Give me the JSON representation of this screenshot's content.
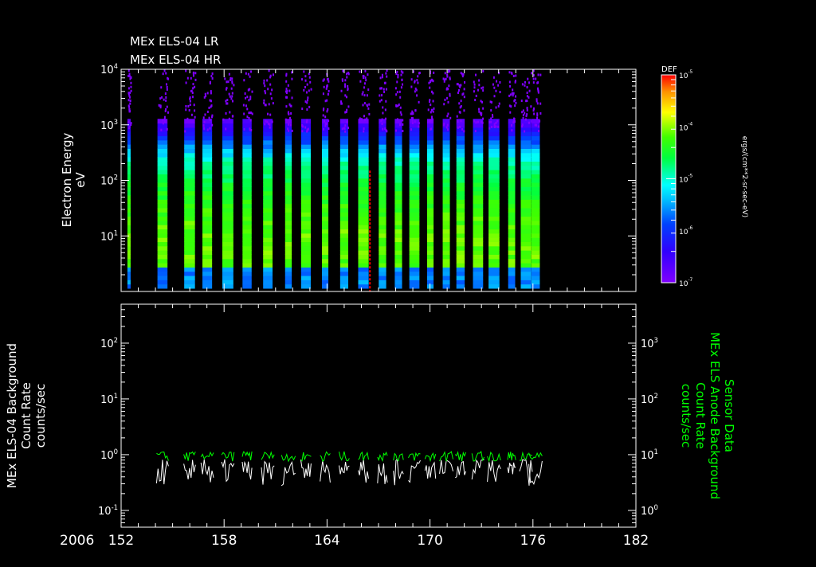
{
  "titles": [
    "MEx ELS-04 LR",
    "MEx ELS-04 HR"
  ],
  "year_label": "2006",
  "colors": {
    "axis": "#ffffff",
    "green_series": "#00ff00",
    "white_series": "#ffffff",
    "marker_line": "#ff0000"
  },
  "chart_data": [
    {
      "type": "heatmap",
      "title": "MEx ELS-04 LR / MEx ELS-04 HR",
      "ylabel": "Electron Energy",
      "yunits": "eV",
      "yscale": "log",
      "ylim": [
        1,
        10000
      ],
      "yticks": [
        {
          "base": "10",
          "exp": "1"
        },
        {
          "base": "10",
          "exp": "2"
        },
        {
          "base": "10",
          "exp": "3"
        },
        {
          "base": "10",
          "exp": "4"
        }
      ],
      "xlim": [
        152,
        182
      ],
      "pass_days": [
        152.46,
        154.41,
        155.99,
        157.02,
        158.22,
        159.34,
        160.55,
        161.75,
        162.77,
        163.89,
        165.0,
        166.12,
        167.23,
        168.16,
        169.09,
        170.02,
        170.95,
        171.78,
        172.8,
        173.73,
        174.76,
        175.59,
        176.15
      ],
      "marker_day": 166.5,
      "colorbar": {
        "label": "DEF",
        "units": "ergs/(cm**2-sr-sec-eV)",
        "scale": "log",
        "range": [
          1e-07,
          1e-05
        ],
        "ticks": [
          {
            "base": "10",
            "exp": "-5"
          },
          {
            "base": "10",
            "exp": "-4"
          },
          {
            "base": "10",
            "exp": "-5"
          },
          {
            "base": "10",
            "exp": "-6"
          },
          {
            "base": "10",
            "exp": "-7"
          }
        ]
      }
    },
    {
      "type": "line",
      "ylabel_left": [
        "MEx ELS-04 Background",
        "Count Rate",
        "counts/sec"
      ],
      "ylabel_right": [
        "Sensor Data",
        "MEx ELS Anode Background",
        "Count Rate",
        "counts/sec"
      ],
      "yscale": "log",
      "ylim_left": [
        0.05,
        500
      ],
      "ylim_right": [
        0.5,
        5000
      ],
      "yticks_left": [
        {
          "base": "10",
          "exp": "-1"
        },
        {
          "base": "10",
          "exp": "0"
        },
        {
          "base": "10",
          "exp": "1"
        },
        {
          "base": "10",
          "exp": "2"
        }
      ],
      "yticks_right": [
        {
          "base": "10",
          "exp": "0"
        },
        {
          "base": "10",
          "exp": "1"
        },
        {
          "base": "10",
          "exp": "2"
        },
        {
          "base": "10",
          "exp": "3"
        }
      ],
      "series": [
        {
          "name": "MEx ELS-04 Background (left axis)",
          "color": "white",
          "typical_value": 0.55
        },
        {
          "name": "MEx ELS Anode Background (right axis)",
          "color": "green",
          "typical_value": 9.5
        }
      ]
    }
  ],
  "xaxis": {
    "ticks": [
      "152",
      "158",
      "164",
      "170",
      "176",
      "182"
    ],
    "tick_values": [
      152,
      158,
      164,
      170,
      176,
      182
    ]
  }
}
